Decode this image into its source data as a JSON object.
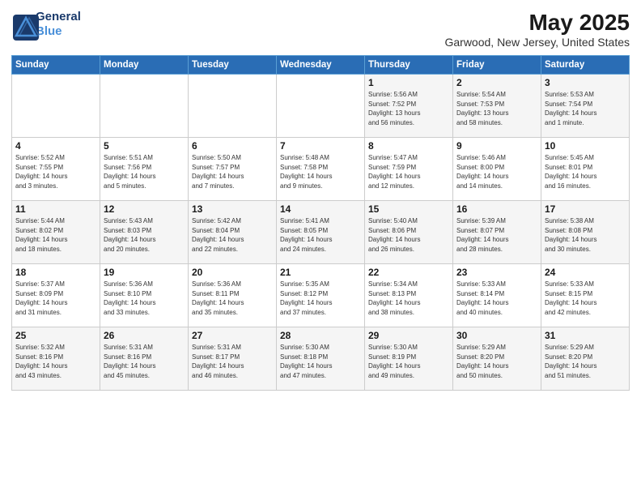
{
  "logo": {
    "line1": "General",
    "line2": "Blue"
  },
  "title": "May 2025",
  "subtitle": "Garwood, New Jersey, United States",
  "days_header": [
    "Sunday",
    "Monday",
    "Tuesday",
    "Wednesday",
    "Thursday",
    "Friday",
    "Saturday"
  ],
  "weeks": [
    [
      {
        "num": "",
        "info": ""
      },
      {
        "num": "",
        "info": ""
      },
      {
        "num": "",
        "info": ""
      },
      {
        "num": "",
        "info": ""
      },
      {
        "num": "1",
        "info": "Sunrise: 5:56 AM\nSunset: 7:52 PM\nDaylight: 13 hours\nand 56 minutes."
      },
      {
        "num": "2",
        "info": "Sunrise: 5:54 AM\nSunset: 7:53 PM\nDaylight: 13 hours\nand 58 minutes."
      },
      {
        "num": "3",
        "info": "Sunrise: 5:53 AM\nSunset: 7:54 PM\nDaylight: 14 hours\nand 1 minute."
      }
    ],
    [
      {
        "num": "4",
        "info": "Sunrise: 5:52 AM\nSunset: 7:55 PM\nDaylight: 14 hours\nand 3 minutes."
      },
      {
        "num": "5",
        "info": "Sunrise: 5:51 AM\nSunset: 7:56 PM\nDaylight: 14 hours\nand 5 minutes."
      },
      {
        "num": "6",
        "info": "Sunrise: 5:50 AM\nSunset: 7:57 PM\nDaylight: 14 hours\nand 7 minutes."
      },
      {
        "num": "7",
        "info": "Sunrise: 5:48 AM\nSunset: 7:58 PM\nDaylight: 14 hours\nand 9 minutes."
      },
      {
        "num": "8",
        "info": "Sunrise: 5:47 AM\nSunset: 7:59 PM\nDaylight: 14 hours\nand 12 minutes."
      },
      {
        "num": "9",
        "info": "Sunrise: 5:46 AM\nSunset: 8:00 PM\nDaylight: 14 hours\nand 14 minutes."
      },
      {
        "num": "10",
        "info": "Sunrise: 5:45 AM\nSunset: 8:01 PM\nDaylight: 14 hours\nand 16 minutes."
      }
    ],
    [
      {
        "num": "11",
        "info": "Sunrise: 5:44 AM\nSunset: 8:02 PM\nDaylight: 14 hours\nand 18 minutes."
      },
      {
        "num": "12",
        "info": "Sunrise: 5:43 AM\nSunset: 8:03 PM\nDaylight: 14 hours\nand 20 minutes."
      },
      {
        "num": "13",
        "info": "Sunrise: 5:42 AM\nSunset: 8:04 PM\nDaylight: 14 hours\nand 22 minutes."
      },
      {
        "num": "14",
        "info": "Sunrise: 5:41 AM\nSunset: 8:05 PM\nDaylight: 14 hours\nand 24 minutes."
      },
      {
        "num": "15",
        "info": "Sunrise: 5:40 AM\nSunset: 8:06 PM\nDaylight: 14 hours\nand 26 minutes."
      },
      {
        "num": "16",
        "info": "Sunrise: 5:39 AM\nSunset: 8:07 PM\nDaylight: 14 hours\nand 28 minutes."
      },
      {
        "num": "17",
        "info": "Sunrise: 5:38 AM\nSunset: 8:08 PM\nDaylight: 14 hours\nand 30 minutes."
      }
    ],
    [
      {
        "num": "18",
        "info": "Sunrise: 5:37 AM\nSunset: 8:09 PM\nDaylight: 14 hours\nand 31 minutes."
      },
      {
        "num": "19",
        "info": "Sunrise: 5:36 AM\nSunset: 8:10 PM\nDaylight: 14 hours\nand 33 minutes."
      },
      {
        "num": "20",
        "info": "Sunrise: 5:36 AM\nSunset: 8:11 PM\nDaylight: 14 hours\nand 35 minutes."
      },
      {
        "num": "21",
        "info": "Sunrise: 5:35 AM\nSunset: 8:12 PM\nDaylight: 14 hours\nand 37 minutes."
      },
      {
        "num": "22",
        "info": "Sunrise: 5:34 AM\nSunset: 8:13 PM\nDaylight: 14 hours\nand 38 minutes."
      },
      {
        "num": "23",
        "info": "Sunrise: 5:33 AM\nSunset: 8:14 PM\nDaylight: 14 hours\nand 40 minutes."
      },
      {
        "num": "24",
        "info": "Sunrise: 5:33 AM\nSunset: 8:15 PM\nDaylight: 14 hours\nand 42 minutes."
      }
    ],
    [
      {
        "num": "25",
        "info": "Sunrise: 5:32 AM\nSunset: 8:16 PM\nDaylight: 14 hours\nand 43 minutes."
      },
      {
        "num": "26",
        "info": "Sunrise: 5:31 AM\nSunset: 8:16 PM\nDaylight: 14 hours\nand 45 minutes."
      },
      {
        "num": "27",
        "info": "Sunrise: 5:31 AM\nSunset: 8:17 PM\nDaylight: 14 hours\nand 46 minutes."
      },
      {
        "num": "28",
        "info": "Sunrise: 5:30 AM\nSunset: 8:18 PM\nDaylight: 14 hours\nand 47 minutes."
      },
      {
        "num": "29",
        "info": "Sunrise: 5:30 AM\nSunset: 8:19 PM\nDaylight: 14 hours\nand 49 minutes."
      },
      {
        "num": "30",
        "info": "Sunrise: 5:29 AM\nSunset: 8:20 PM\nDaylight: 14 hours\nand 50 minutes."
      },
      {
        "num": "31",
        "info": "Sunrise: 5:29 AM\nSunset: 8:20 PM\nDaylight: 14 hours\nand 51 minutes."
      }
    ]
  ]
}
